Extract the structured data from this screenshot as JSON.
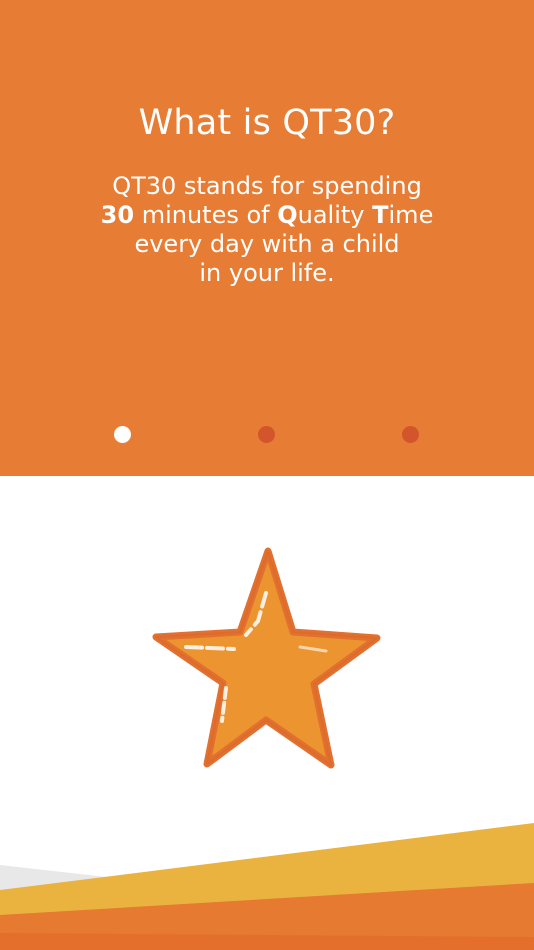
{
  "slide": {
    "title": "What is QT30?",
    "lines": [
      {
        "pre": "QT30 stands for spending"
      },
      {
        "b1": "30",
        "t1": " minutes of ",
        "b2": "Q",
        "t2": "uality ",
        "b3": "T",
        "t3": "ime"
      },
      {
        "pre": "every day with a child"
      },
      {
        "pre": "in your life."
      }
    ]
  },
  "pager": {
    "current_page": 1,
    "total_pages": 3
  },
  "colors": {
    "header_orange": "#e77d34",
    "dot_active": "#ffffff",
    "dot_inactive": "#d4542b",
    "star_fill": "#ec9430",
    "star_stroke": "#e2702f",
    "wave_yellow": "#eab340",
    "wave_orange": "#e57a30",
    "wave_grey": "#e8e8e8"
  },
  "icons": {
    "hero": "star-icon"
  }
}
